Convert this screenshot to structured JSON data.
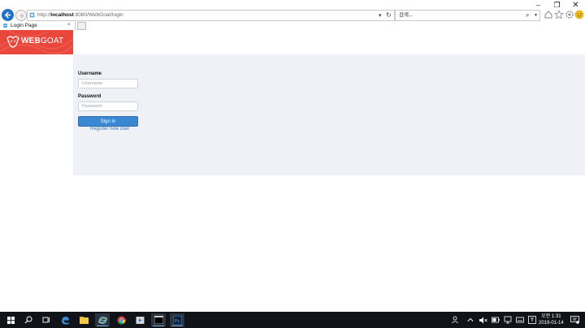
{
  "window_controls": {
    "minimize": "–",
    "restore": "❐",
    "close": "✕"
  },
  "browser": {
    "url_prefix": "http://",
    "url_host": "localhost",
    "url_rest": ":8080/WebGoat/login",
    "search_placeholder": "검색...",
    "tab": {
      "title": "Login Page",
      "close": "×"
    }
  },
  "brand": {
    "web": "WEB",
    "goat": "GOAT"
  },
  "login": {
    "username_label": "Username",
    "username_placeholder": "Username",
    "password_label": "Password",
    "password_placeholder": "Password",
    "signin_label": "Sign in",
    "register_label": "Register new user"
  },
  "taskbar": {
    "time_line1": "오전 1:31",
    "time_line2": "2019-01-14",
    "apps": [
      "start-icon",
      "search-icon",
      "task-view-icon",
      "edge-icon",
      "file-explorer-icon",
      "internet-explorer-icon",
      "chrome-icon",
      "media-player-icon",
      "terminal-icon",
      "photoshop-icon"
    ]
  },
  "colors": {
    "brand": "#e9473b",
    "primary": "#3a87d4",
    "panel": "#eff1f6",
    "taskbar": "#101419"
  }
}
